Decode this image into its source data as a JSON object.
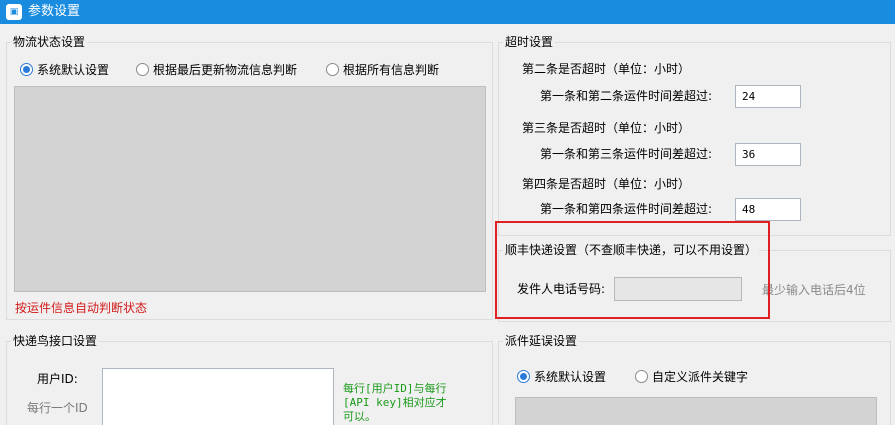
{
  "window": {
    "title": "参数设置",
    "icon": "app-logo-icon"
  },
  "logistics_status": {
    "legend": "物流状态设置",
    "options": [
      "系统默认设置",
      "根据最后更新物流信息判断",
      "根据所有信息判断"
    ],
    "selected": 0,
    "note": "按运件信息自动判断状态"
  },
  "timeout": {
    "legend": "超时设置",
    "rows": [
      {
        "heading": "第二条是否超时（单位：小时）",
        "label": "第一条和第二条运件时间差超过:",
        "value": "24"
      },
      {
        "heading": "第三条是否超时（单位：小时）",
        "label": "第一条和第三条运件时间差超过:",
        "value": "36"
      },
      {
        "heading": "第四条是否超时（单位：小时）",
        "label": "第一条和第四条运件时间差超过:",
        "value": "48"
      }
    ]
  },
  "sf": {
    "legend": "顺丰快递设置（不查顺丰快递，可以不用设置）",
    "phone_label": "发件人电话号码:",
    "phone_value": "",
    "hint": "最少输入电话后4位"
  },
  "kdniao": {
    "legend": "快递鸟接口设置",
    "user_id_label": "用户ID:",
    "user_id_hint": "每行一个ID",
    "note": "每行[用户ID]与每行\n[API key]相对应才\n可以。"
  },
  "delay": {
    "legend": "派件延误设置",
    "options": [
      "系统默认设置",
      "自定义派件关键字"
    ],
    "selected": 0
  },
  "colors": {
    "titlebar": "#1a8ce0",
    "highlight": "#e02020",
    "note_red": "#d21a1a",
    "note_green": "#1a9a1a"
  }
}
